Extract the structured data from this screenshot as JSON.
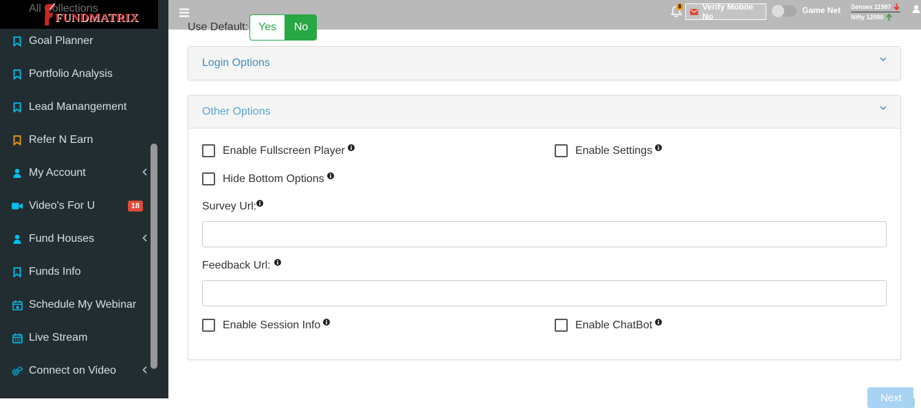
{
  "sidebar": {
    "logo_text": "FUNDMATRIX",
    "partial_item": "All Collections",
    "items": [
      {
        "label": "Goal Planner",
        "icon": "bookmark-icon"
      },
      {
        "label": "Portfolio Analysis",
        "icon": "bookmark-icon"
      },
      {
        "label": "Lead Manangement",
        "icon": "bookmark-icon"
      },
      {
        "label": "Refer N Earn",
        "icon": "bookmark-icon"
      },
      {
        "label": "My Account",
        "icon": "user-icon"
      },
      {
        "label": "Video's For U",
        "icon": "video-icon",
        "badge": "18"
      },
      {
        "label": "Fund Houses",
        "icon": "user-icon"
      },
      {
        "label": "Funds Info",
        "icon": "bookmark-icon"
      },
      {
        "label": "Schedule My Webinar",
        "icon": "calendar-plus-icon"
      },
      {
        "label": "Live Stream",
        "icon": "calendar-icon"
      },
      {
        "label": "Connect on Video",
        "icon": "cogs-icon"
      }
    ],
    "colors": {
      "bg": "#222d32",
      "icon": "#00c0ef",
      "refer_icon": "#f39c12",
      "badge": "#dd4b39"
    }
  },
  "topbar": {
    "notification_count": "8",
    "verify_label": "Verify Mobile No",
    "gamenet_label": "Game Net",
    "sensex_label": "Sensex 11987",
    "nifty_label": "Nifty   12000"
  },
  "form": {
    "use_default_label": "Use Default:",
    "yes_label": "Yes",
    "no_label": "No",
    "login_options_title": "Login Options",
    "other_options_title": "Other Options",
    "enable_fullscreen_label": "Enable Fullscreen Player",
    "enable_settings_label": "Enable Settings",
    "hide_bottom_label": "Hide Bottom Options",
    "survey_url_label": "Survey Url:",
    "survey_url_value": "",
    "feedback_url_label": "Feedback Url:",
    "feedback_url_value": "",
    "enable_session_label": "Enable Session Info",
    "enable_chatbot_label": "Enable ChatBot",
    "next_label": "Next"
  }
}
